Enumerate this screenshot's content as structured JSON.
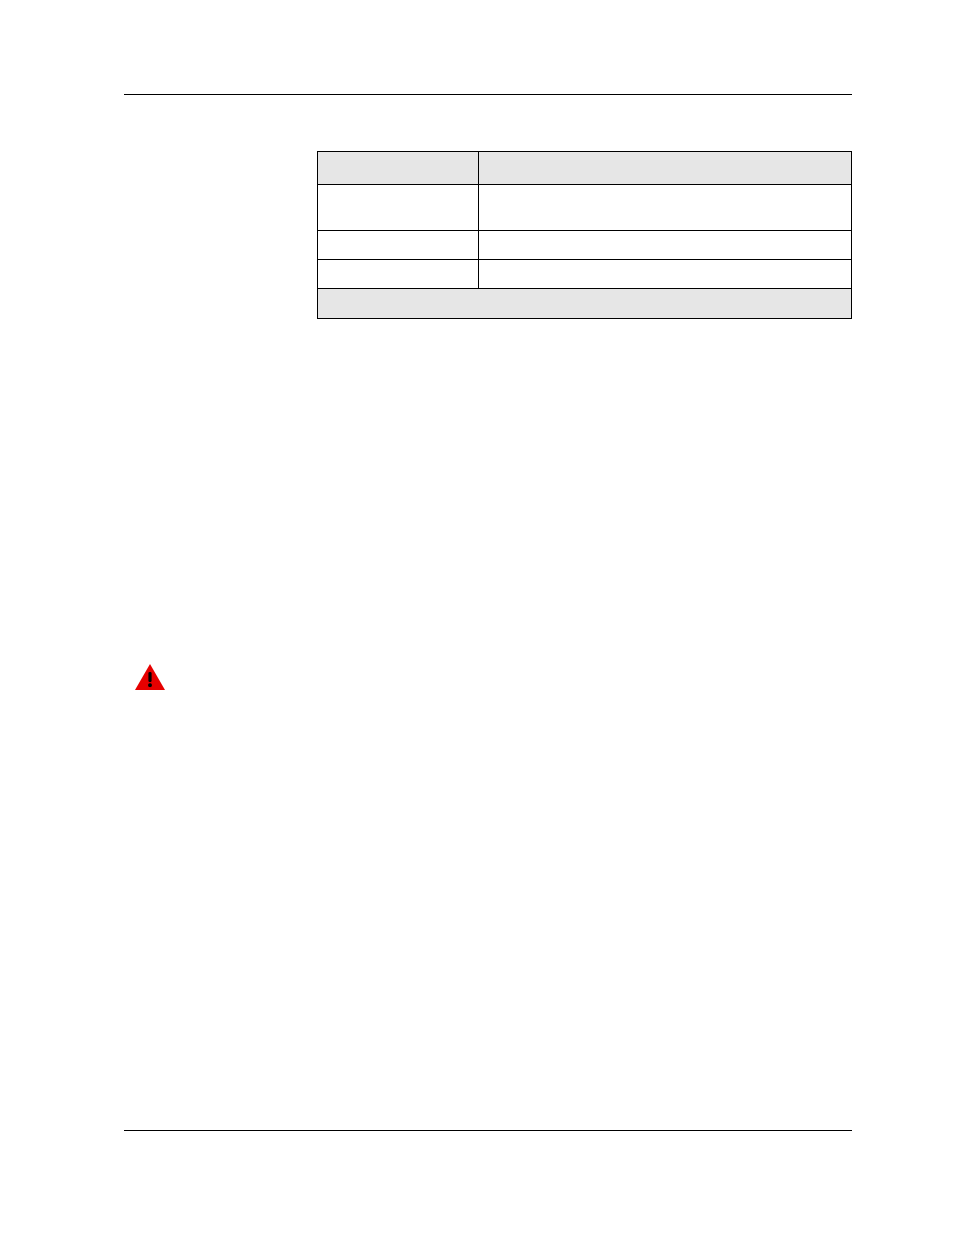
{
  "table": {
    "header": {
      "c1": "",
      "c2": ""
    },
    "rows": [
      {
        "c1": "",
        "c2": ""
      },
      {
        "c1": "",
        "c2": ""
      },
      {
        "c1": "",
        "c2": ""
      }
    ],
    "footer": ""
  }
}
